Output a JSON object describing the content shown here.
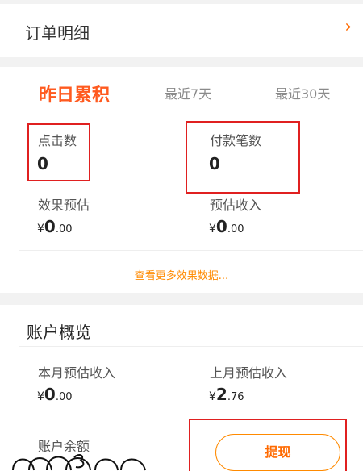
{
  "order": {
    "title": "订单明细",
    "arrow": "›"
  },
  "tabs": {
    "yesterday": "昨日累积",
    "last7": "最近7天",
    "last30": "最近30天"
  },
  "metrics": {
    "clicks_label": "点击数",
    "clicks_value": "0",
    "payments_label": "付款笔数",
    "payments_value": "0",
    "effect_label": "效果预估",
    "effect_currency": "¥",
    "effect_int": "0",
    "effect_dec": ".00",
    "income_label": "预估收入",
    "income_currency": "¥",
    "income_int": "0",
    "income_dec": ".00"
  },
  "more_link": "查看更多效果数据...",
  "account": {
    "title": "账户概览",
    "this_month_label": "本月预估收入",
    "this_month_currency": "¥",
    "this_month_int": "0",
    "this_month_dec": ".00",
    "last_month_label": "上月预估收入",
    "last_month_currency": "¥",
    "last_month_int": "2",
    "last_month_dec": ".76",
    "balance_label": "账户余额",
    "withdraw_label": "提现"
  },
  "colors": {
    "accent": "#ff5a1f",
    "highlight_box": "#e02020",
    "link": "#ff8a00"
  }
}
